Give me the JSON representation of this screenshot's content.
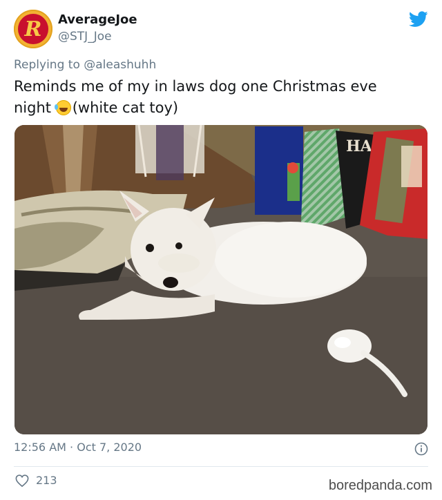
{
  "author": {
    "display_name": "AverageJoe",
    "handle": "@STJ_Joe",
    "avatar_letter": "R"
  },
  "reply": {
    "text": "Replying to @aleashuhh"
  },
  "tweet": {
    "line1": "Reminds me of my in laws dog one Christmas eve",
    "line2_prefix": "night",
    "emoji": "rolling-on-floor-laughing-emoji",
    "line2_suffix": "(white cat toy)"
  },
  "meta": {
    "time": "12:56 AM",
    "separator": "·",
    "date": "Oct 7, 2020"
  },
  "likes": {
    "count": "213"
  },
  "watermark": "boredpanda.com",
  "gift_bag_text": "HA",
  "colors": {
    "twitter_blue": "#1da1f2",
    "muted_text": "#657786",
    "avatar_gold": "#f3b233",
    "avatar_red": "#c8102e"
  },
  "icons": [
    "twitter-bird-icon",
    "info-icon",
    "heart-icon"
  ]
}
